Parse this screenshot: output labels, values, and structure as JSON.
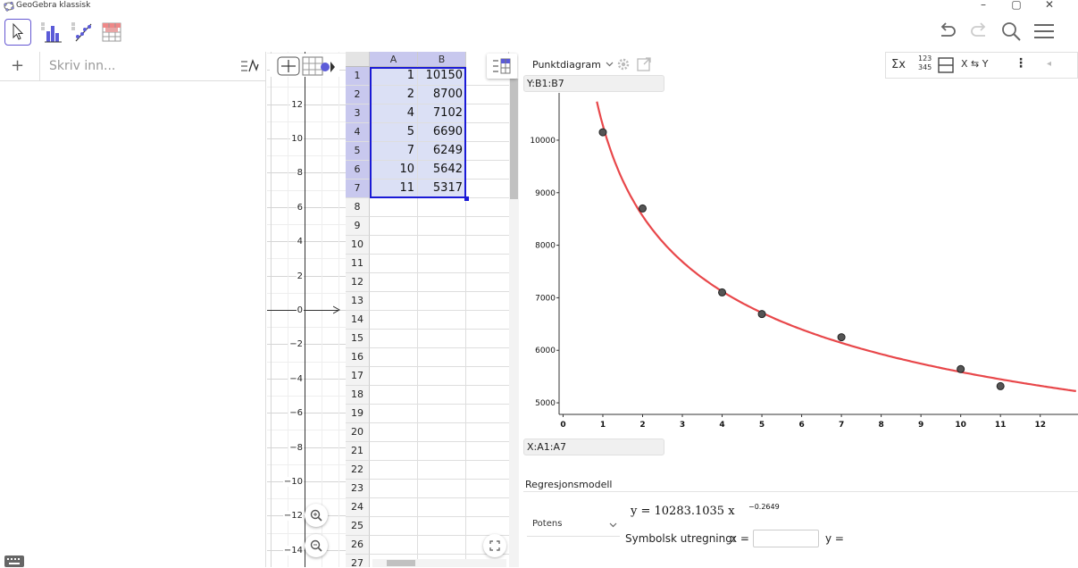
{
  "window": {
    "title": "GeoGebra klassisk",
    "controls": {
      "minimize": "–",
      "maximize": "▢",
      "close": "✕"
    }
  },
  "algebra": {
    "add_label": "+",
    "input_placeholder": "Skriv inn..."
  },
  "graphics": {
    "y_ticks": [
      "12",
      "10",
      "8",
      "6",
      "4",
      "2",
      "0",
      "−2",
      "−4",
      "−6",
      "−8",
      "−10",
      "−12",
      "−14"
    ]
  },
  "spreadsheet": {
    "col_headers": [
      "A",
      "B"
    ],
    "rows": [
      {
        "n": "1",
        "a": "1",
        "b": "10150"
      },
      {
        "n": "2",
        "a": "2",
        "b": "8700"
      },
      {
        "n": "3",
        "a": "4",
        "b": "7102"
      },
      {
        "n": "4",
        "a": "5",
        "b": "6690"
      },
      {
        "n": "5",
        "a": "7",
        "b": "6249"
      },
      {
        "n": "6",
        "a": "10",
        "b": "5642"
      },
      {
        "n": "7",
        "a": "11",
        "b": "5317"
      },
      {
        "n": "8",
        "a": "",
        "b": ""
      },
      {
        "n": "9",
        "a": "",
        "b": ""
      },
      {
        "n": "10",
        "a": "",
        "b": ""
      },
      {
        "n": "11",
        "a": "",
        "b": ""
      },
      {
        "n": "12",
        "a": "",
        "b": ""
      },
      {
        "n": "13",
        "a": "",
        "b": ""
      },
      {
        "n": "14",
        "a": "",
        "b": ""
      },
      {
        "n": "15",
        "a": "",
        "b": ""
      },
      {
        "n": "16",
        "a": "",
        "b": ""
      },
      {
        "n": "17",
        "a": "",
        "b": ""
      },
      {
        "n": "18",
        "a": "",
        "b": ""
      },
      {
        "n": "19",
        "a": "",
        "b": ""
      },
      {
        "n": "20",
        "a": "",
        "b": ""
      },
      {
        "n": "21",
        "a": "",
        "b": ""
      },
      {
        "n": "22",
        "a": "",
        "b": ""
      },
      {
        "n": "23",
        "a": "",
        "b": ""
      },
      {
        "n": "24",
        "a": "",
        "b": ""
      },
      {
        "n": "25",
        "a": "",
        "b": ""
      },
      {
        "n": "26",
        "a": "",
        "b": ""
      },
      {
        "n": "27",
        "a": "",
        "b": ""
      }
    ]
  },
  "analysis": {
    "plot_type": "Punktdiagram",
    "y_source": "Y:B1:B7",
    "x_source": "X:A1:A7",
    "regression_label": "Regresjonsmodell",
    "model": "Potens",
    "equation": "y = 10283.1035 x",
    "exponent": "−0.2649",
    "symbolic_label": "Symbolsk utregning:",
    "x_eq": "x =",
    "y_eq": "y =",
    "toolbar": {
      "sum": "Σx",
      "nums_top": "123",
      "nums_bottom": "345",
      "swap": "X ⇆ Y",
      "more": "⋮",
      "collapse": "◂"
    }
  },
  "chart_data": {
    "type": "scatter",
    "x": [
      1,
      2,
      4,
      5,
      7,
      10,
      11
    ],
    "y": [
      10150,
      8700,
      7102,
      6690,
      6249,
      5642,
      5317
    ],
    "x_ticks": [
      "0",
      "1",
      "2",
      "3",
      "4",
      "5",
      "6",
      "7",
      "8",
      "9",
      "10",
      "11",
      "12"
    ],
    "y_ticks": [
      "5000",
      "6000",
      "7000",
      "8000",
      "9000",
      "10000"
    ],
    "xlim": [
      -0.1,
      12.95
    ],
    "ylim": [
      4780,
      10900
    ],
    "regression": {
      "model": "power",
      "a": 10283.1035,
      "b": -0.2649
    },
    "colors": {
      "points": "#555555",
      "curve": "#e8474a"
    }
  }
}
